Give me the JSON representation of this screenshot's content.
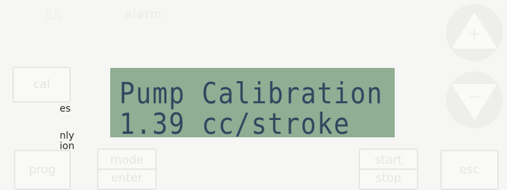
{
  "top_bar": {
    "pulse_glyph": "⎍⎍",
    "alarm_label": "alarm"
  },
  "side_text": {
    "line1": "es",
    "line2": "nly",
    "line3": "ion"
  },
  "display": {
    "line1": "Pump Calibration",
    "line2": "1.39 cc/stroke"
  },
  "buttons": {
    "cal": "cal",
    "prog": "prog",
    "mode": "mode",
    "enter": "enter",
    "start": "start",
    "stop": "stop",
    "esc": "esc"
  },
  "icons": {
    "up": "arrow-up-icon",
    "down": "arrow-down-icon"
  },
  "colors": {
    "lcd_background": "#8fae94",
    "lcd_text": "#33465f",
    "panel": "#f6f6f4"
  }
}
